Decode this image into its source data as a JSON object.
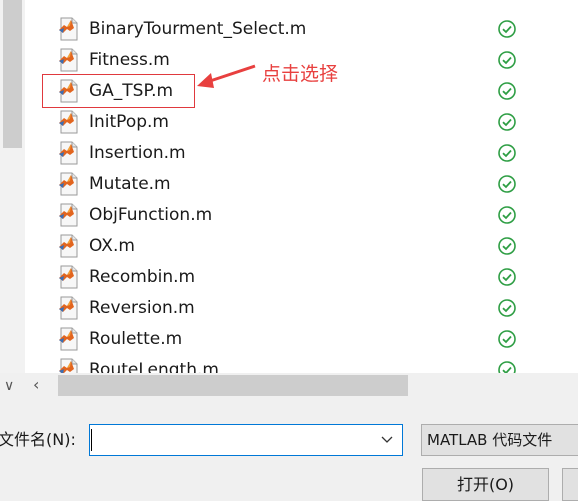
{
  "files": [
    {
      "name": "BinaryTourment_Select.m",
      "status": "ok"
    },
    {
      "name": "Fitness.m",
      "status": "ok"
    },
    {
      "name": "GA_TSP.m",
      "status": "ok"
    },
    {
      "name": "InitPop.m",
      "status": "ok"
    },
    {
      "name": "Insertion.m",
      "status": "ok"
    },
    {
      "name": "Mutate.m",
      "status": "ok"
    },
    {
      "name": "ObjFunction.m",
      "status": "ok"
    },
    {
      "name": "OX.m",
      "status": "ok"
    },
    {
      "name": "Recombin.m",
      "status": "ok"
    },
    {
      "name": "Reversion.m",
      "status": "ok"
    },
    {
      "name": "Roulette.m",
      "status": "ok"
    },
    {
      "name": "RouteLength.m",
      "status": "ok"
    }
  ],
  "annotation": {
    "text": "点击选择",
    "color": "#e8403f"
  },
  "filename_field": {
    "label": "文件名(N):",
    "value": ""
  },
  "filetype": {
    "selected": "MATLAB 代码文件"
  },
  "buttons": {
    "open": "打开(O)"
  },
  "icons": {
    "file": "matlab-file-icon",
    "status": "check-circle-icon",
    "scroll_down": "chevron-down-icon",
    "scroll_left": "chevron-left-icon",
    "dropdown": "chevron-down-icon"
  },
  "colors": {
    "accent": "#0078d7",
    "status_ok": "#2e9e44",
    "annotation": "#e0393e"
  }
}
